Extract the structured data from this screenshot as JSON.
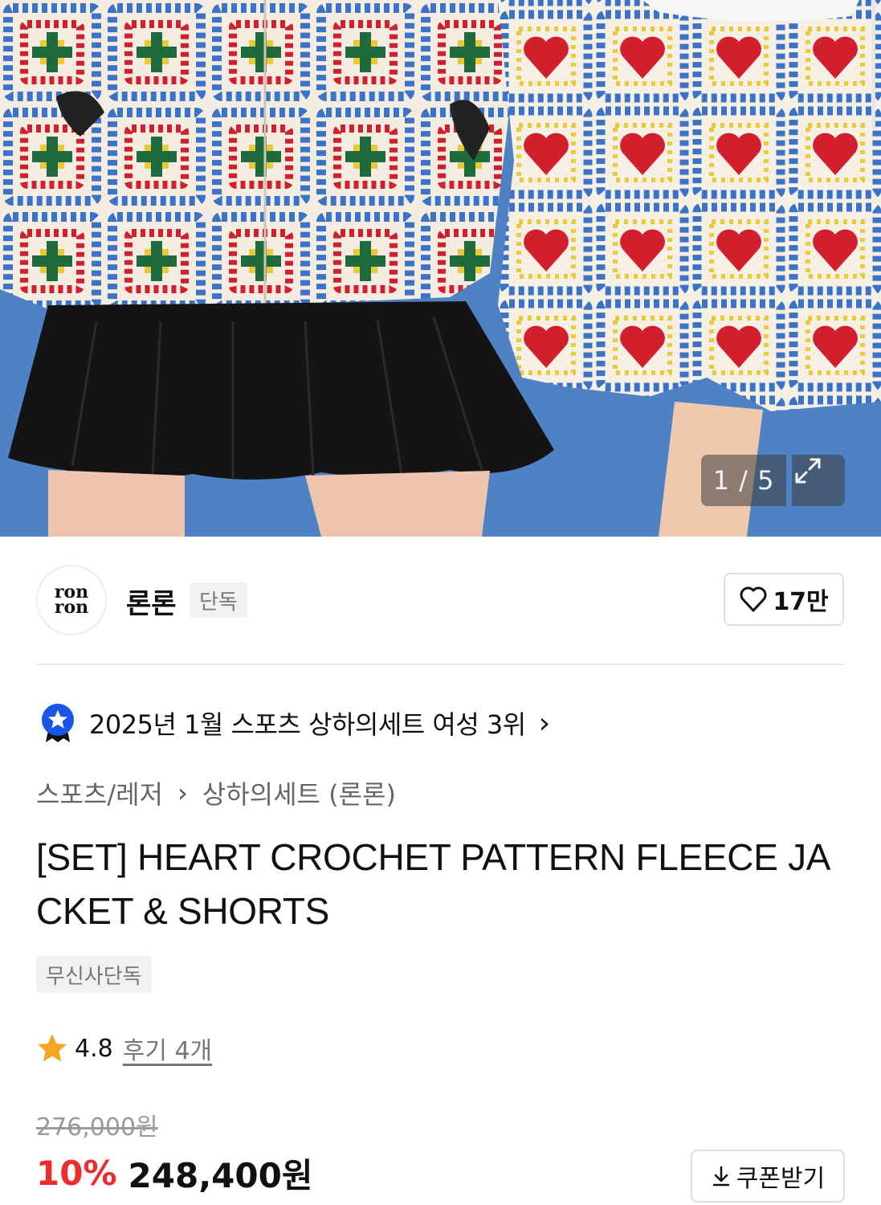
{
  "gallery": {
    "counter": "1 / 5"
  },
  "brand": {
    "logo_line1": "ron",
    "logo_line2": "ron",
    "name": "론론",
    "tag": "단독",
    "likes": "17만"
  },
  "ranking": {
    "text": "2025년 1월 스포츠 상하의세트 여성 3위",
    "arrow": "›"
  },
  "breadcrumb": {
    "category": "스포츠/레저",
    "separator": "›",
    "subcategory": "상하의세트 (론론)"
  },
  "product": {
    "title": "[SET] HEART CROCHET PATTERN FLEECE JACKET & SHORTS",
    "exclusive_tag": "무신사단독",
    "rating": "4.8",
    "reviews": "후기 4개",
    "original_price": "276,000원",
    "discount": "10%",
    "price": "248,400원"
  },
  "coupon": {
    "label": "쿠폰받기"
  },
  "colors": {
    "discount": "#ee2c2c",
    "star": "#f5a623",
    "rank_badge": "#1a56e6",
    "backdrop": "#4f82c4"
  },
  "icons": [
    "expand-icon",
    "heart-icon",
    "rank-badge-icon",
    "chevron-right-icon",
    "star-icon",
    "download-icon"
  ]
}
